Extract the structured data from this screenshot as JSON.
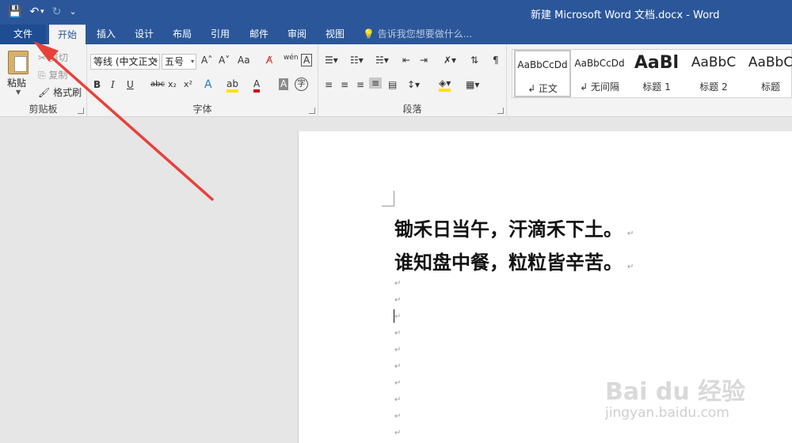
{
  "title_bar": {
    "title": "新建 Microsoft Word 文档.docx - Word",
    "save_icon": "💾",
    "undo_icon": "↶",
    "undo_dropdown": "▾",
    "redo_icon": "↻",
    "customize_icon": "⌄"
  },
  "tabs": {
    "file": "文件",
    "home": "开始",
    "insert": "插入",
    "design": "设计",
    "layout": "布局",
    "references": "引用",
    "mailings": "邮件",
    "review": "审阅",
    "view": "视图",
    "tell_me": "告诉我您想要做什么..."
  },
  "clipboard": {
    "paste": "粘贴",
    "cut": "剪切",
    "copy": "复制",
    "format_painter": "格式刷",
    "group_label": "剪贴板"
  },
  "font": {
    "font_name": "等线 (中文正文",
    "font_size": "五号",
    "grow": "A˄",
    "shrink": "A˅",
    "change_case": "Aa",
    "clear_format": "A̸",
    "phonetic": "wén",
    "char_border": "A",
    "bold": "B",
    "italic": "I",
    "underline": "U",
    "strikethrough": "abc",
    "subscript": "x₂",
    "superscript": "x²",
    "text_effects": "A",
    "highlight": "ab",
    "font_color": "A",
    "char_shading": "A",
    "enclose": "字",
    "group_label": "字体"
  },
  "paragraph": {
    "group_label": "段落"
  },
  "styles": {
    "items": [
      {
        "sample": "AaBbCcDd",
        "name": "↲ 正文"
      },
      {
        "sample": "AaBbCcDd",
        "name": "↲ 无间隔"
      },
      {
        "sample": "AaBl",
        "name": "标题 1"
      },
      {
        "sample": "AaBbC",
        "name": "标题 2"
      },
      {
        "sample": "AaBbC",
        "name": "标题"
      }
    ]
  },
  "document": {
    "line1": "锄禾日当午，汗滴禾下土。",
    "line2": "谁知盘中餐，粒粒皆辛苦。",
    "para_mark": "↵"
  },
  "watermark": {
    "brand": "Bai du 经验",
    "url": "jingyan.baidu.com"
  },
  "colors": {
    "title_bar": "#2b579a",
    "ribbon": "#f3f3f3",
    "annotation_arrow": "#e8413a"
  }
}
